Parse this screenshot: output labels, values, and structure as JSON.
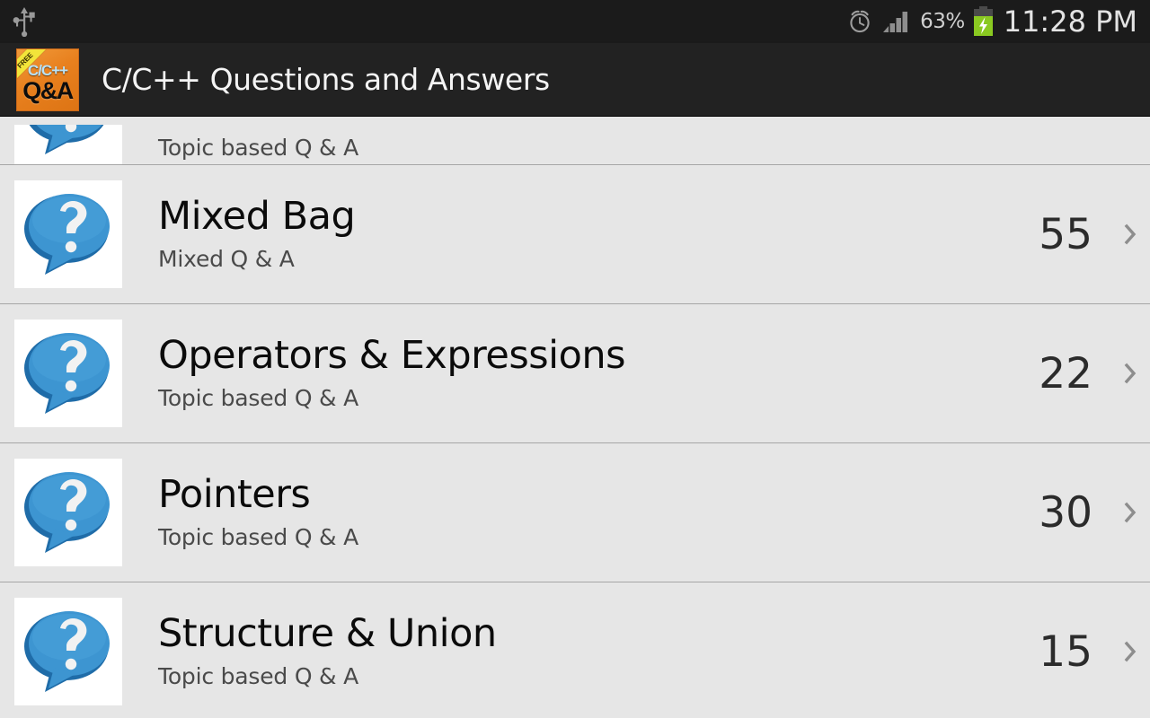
{
  "status_bar": {
    "usb_icon": "usb-icon",
    "alarm_icon": "alarm-clock-icon",
    "signal_icon": "signal-bars-icon",
    "battery_percent": "63%",
    "battery_icon": "battery-charging-icon",
    "clock": "11:28 PM",
    "background": "#1b1b1b",
    "battery_color": "#8ac921"
  },
  "action_bar": {
    "app_icon": {
      "ribbon_label": "FREE",
      "line1": "C/C++",
      "line2": "Q&A",
      "background": "#e8801e",
      "ribbon_color": "#f2e53a",
      "line1_color": "#b8e2f7"
    },
    "title": "C/C++ Questions and Answers",
    "background": "#222222"
  },
  "list": {
    "background": "#e6e6e6",
    "divider_color": "#a6a6a6",
    "rows": [
      {
        "icon": "question-bubble-icon",
        "title": "",
        "subtitle": "Topic based Q & A",
        "count": "",
        "chevron": "chevron-right-icon",
        "clipped": true
      },
      {
        "icon": "question-bubble-icon",
        "title": "Mixed Bag",
        "subtitle": "Mixed Q & A",
        "count": "55",
        "chevron": "chevron-right-icon",
        "clipped": false
      },
      {
        "icon": "question-bubble-icon",
        "title": "Operators & Expressions",
        "subtitle": "Topic based Q & A",
        "count": "22",
        "chevron": "chevron-right-icon",
        "clipped": false
      },
      {
        "icon": "question-bubble-icon",
        "title": "Pointers",
        "subtitle": "Topic based Q & A",
        "count": "30",
        "chevron": "chevron-right-icon",
        "clipped": false
      },
      {
        "icon": "question-bubble-icon",
        "title": "Structure & Union",
        "subtitle": "Topic based Q & A",
        "count": "15",
        "chevron": "chevron-right-icon",
        "clipped": false
      }
    ]
  }
}
